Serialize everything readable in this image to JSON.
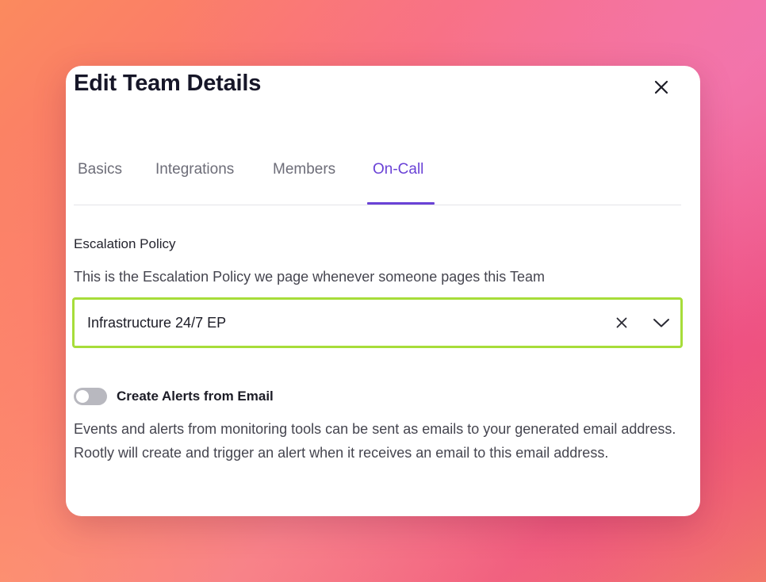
{
  "modal": {
    "title": "Edit Team Details",
    "close_label": "close"
  },
  "tabs": [
    {
      "label": "Basics",
      "active": false
    },
    {
      "label": "Integrations",
      "active": false
    },
    {
      "label": "Members",
      "active": false
    },
    {
      "label": "On-Call",
      "active": true
    }
  ],
  "escalation": {
    "label": "Escalation Policy",
    "description": "This is the Escalation Policy we page whenever someone pages this Team",
    "selected_value": "Infrastructure 24/7 EP"
  },
  "email_alerts": {
    "toggle_label": "Create Alerts from Email",
    "toggle_on": false,
    "description": "Events and alerts from monitoring tools can be sent as emails to your generated email address. Rootly will create and trigger an alert when it receives an email to this email address."
  },
  "colors": {
    "accent": "#6a42d6",
    "focus_border": "#a7dd3a",
    "toggle_off": "#b8b8bf",
    "title_text": "#161628"
  },
  "icons": {
    "close": "close-icon",
    "clear": "clear-icon",
    "chevron": "chevron-down-icon"
  }
}
